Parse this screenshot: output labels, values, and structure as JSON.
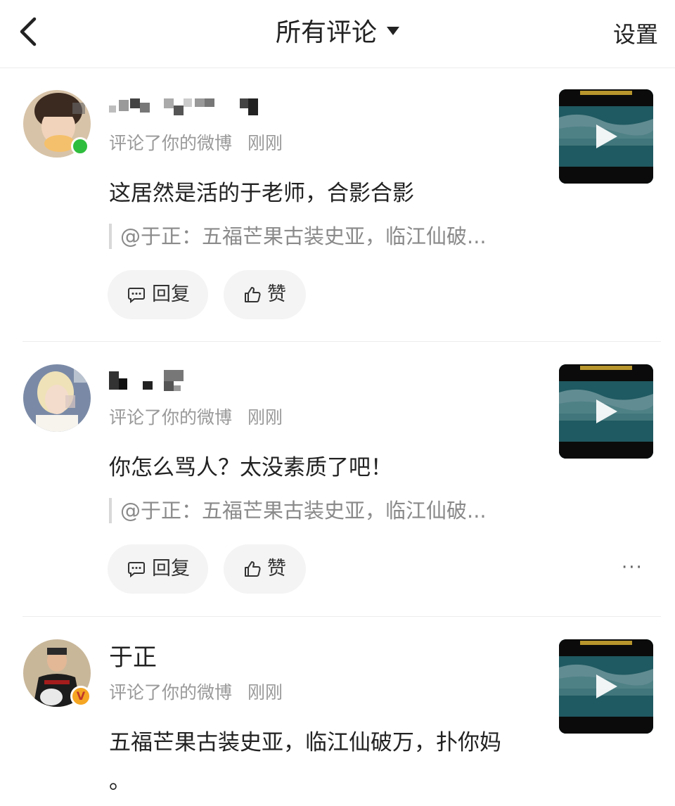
{
  "header": {
    "back_label": "<",
    "title": "所有评论",
    "settings_label": "设置"
  },
  "comments": [
    {
      "username": "",
      "username_obscured": true,
      "action": "评论了你的微博",
      "time": "刚刚",
      "text": "这居然是活的于老师，合影合影",
      "quote": "@于正：五福芒果古装史亚，临江仙破...",
      "reply_label": "回复",
      "like_label": "赞",
      "avatar_badge": "online"
    },
    {
      "username": "",
      "username_obscured": true,
      "action": "评论了你的微博",
      "time": "刚刚",
      "text": "你怎么骂人？太没素质了吧！",
      "quote": "@于正：五福芒果古装史亚，临江仙破...",
      "reply_label": "回复",
      "like_label": "赞",
      "avatar_badge": "none"
    },
    {
      "username": "于正",
      "username_obscured": false,
      "action": "评论了你的微博",
      "time": "刚刚",
      "text_line1": "五福芒果古装史亚，临江仙破万，扑你妈",
      "text_line2": "。",
      "avatar_badge": "verified"
    }
  ],
  "more_label": "···",
  "colors": {
    "background": "#ffffff",
    "text_primary": "#222222",
    "text_secondary": "#999999",
    "pill_bg": "#f4f4f4",
    "online_green": "#2fbd3d",
    "verified_orange": "#f5a623",
    "thumb_teal": "#0c3a40"
  },
  "icons": {
    "back": "chevron-left-icon",
    "dropdown": "caret-down-icon",
    "reply": "comment-bubble-icon",
    "like": "thumbs-up-icon",
    "play": "play-icon",
    "more": "more-dots-icon"
  }
}
